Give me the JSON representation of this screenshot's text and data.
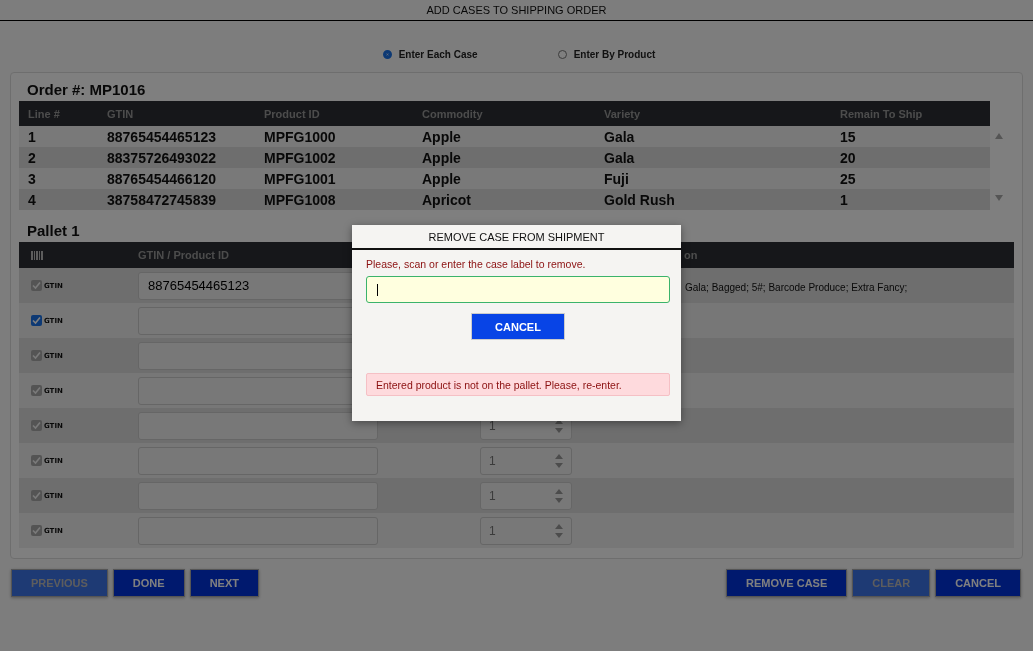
{
  "title": "ADD CASES TO SHIPPING ORDER",
  "entry_mode": [
    {
      "label": "Enter Each Case",
      "selected": true
    },
    {
      "label": "Enter By Product",
      "selected": false
    }
  ],
  "order": {
    "heading": "Order #: MP1016",
    "columns": [
      "Line #",
      "GTIN",
      "Product ID",
      "Commodity",
      "Variety",
      "Remain To Ship"
    ],
    "rows": [
      [
        "1",
        "88765454465123",
        "MPFG1000",
        "Apple",
        "Gala",
        "15"
      ],
      [
        "2",
        "88375726493022",
        "MPFG1002",
        "Apple",
        "Gala",
        "20"
      ],
      [
        "3",
        "88765454466120",
        "MPFG1001",
        "Apple",
        "Fuji",
        "25"
      ],
      [
        "4",
        "38758472745839",
        "MPFG1008",
        "Apricot",
        "Gold Rush",
        "1"
      ]
    ]
  },
  "pallet": {
    "heading": "Pallet 1",
    "columns": [
      "GTIN / Product ID",
      "on"
    ],
    "rows": [
      {
        "checked": true,
        "disabled": true,
        "label": "GTIN",
        "value": "88765454465123",
        "description": "Gala; Bagged; 5#; Barcode Produce; Extra Fancy;"
      },
      {
        "checked": true,
        "disabled": false,
        "label": "GTIN"
      },
      {
        "checked": true,
        "disabled": true,
        "label": "GTIN"
      },
      {
        "checked": true,
        "disabled": true,
        "label": "GTIN"
      },
      {
        "checked": true,
        "disabled": true,
        "label": "GTIN",
        "quantity": "1"
      },
      {
        "checked": true,
        "disabled": true,
        "label": "GTIN",
        "quantity": "1"
      },
      {
        "checked": true,
        "disabled": true,
        "label": "GTIN",
        "quantity": "1"
      },
      {
        "checked": true,
        "disabled": true,
        "label": "GTIN",
        "quantity": "1"
      }
    ]
  },
  "buttons_left": [
    {
      "label": "PREVIOUS",
      "disabled": true
    },
    {
      "label": "DONE",
      "disabled": false
    },
    {
      "label": "NEXT",
      "disabled": false
    }
  ],
  "buttons_right": [
    {
      "label": "REMOVE CASE",
      "disabled": false
    },
    {
      "label": "CLEAR",
      "disabled": true
    },
    {
      "label": "CANCEL",
      "disabled": false
    }
  ],
  "dialog": {
    "title": "REMOVE CASE FROM SHIPMENT",
    "prompt": "Please, scan or enter the case label to remove.",
    "cancel": "CANCEL",
    "error": "Entered product is not on the pallet. Please, re-enter."
  }
}
